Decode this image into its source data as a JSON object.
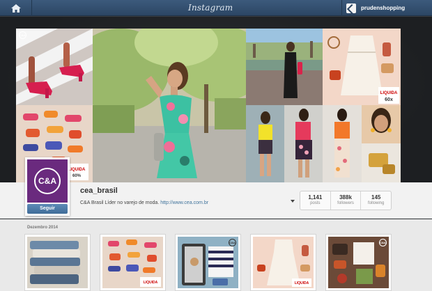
{
  "topbar": {
    "logo_text": "Instagram",
    "username": "prudenshopping",
    "icons": [
      "home-icon",
      "user-avatar-icon"
    ]
  },
  "header": {
    "mosaic_badge_text": "C&A",
    "tile_labels": [
      {
        "top": "LIQUIDA",
        "bottom": "ATÉ 60%"
      },
      {
        "top": "LIQUIDA",
        "bottom": "60x R$"
      }
    ]
  },
  "profile": {
    "avatar_logo_text": "C&A",
    "follow_label": "Seguir",
    "name": "cea_brasil",
    "bio_text": "C&A Brasil Líder no varejo de moda.",
    "bio_link": "http://www.cea.com.br",
    "stats": [
      {
        "value": "1,141",
        "label": "posts"
      },
      {
        "value": "388k",
        "label": "followers"
      },
      {
        "value": "145",
        "label": "following"
      }
    ]
  },
  "feed": {
    "date_label": "Dezembro 2014",
    "thumb_badge": "C&A",
    "thumb_tag": "LIQUIDA"
  },
  "colors": {
    "topbar": "#34516f",
    "brand_purple": "#6a2a7e",
    "follow_button": "#4f7ca8",
    "link": "#3f729b"
  }
}
